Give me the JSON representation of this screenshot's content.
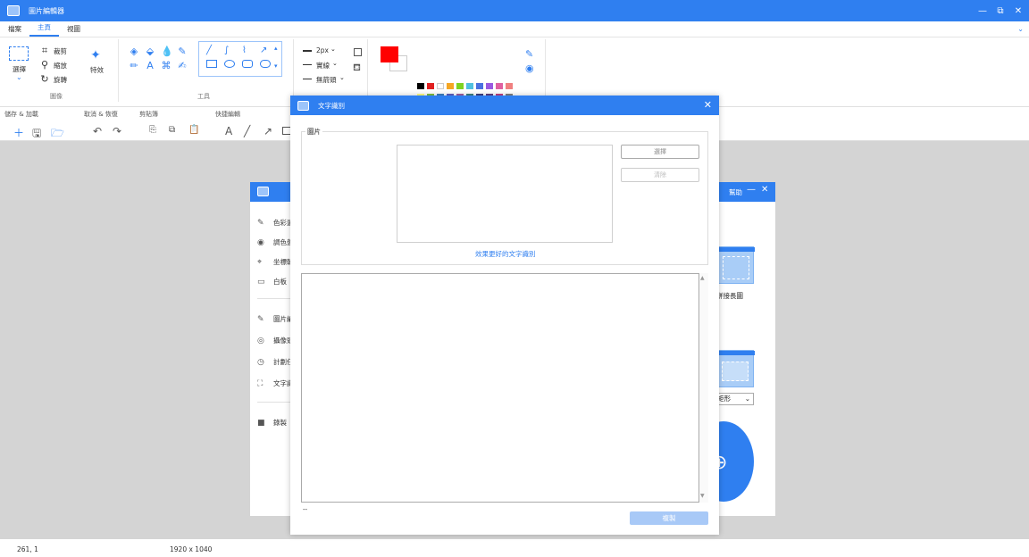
{
  "app": {
    "title": "圖片編輯器"
  },
  "menu": {
    "tabs": [
      "檔案",
      "主頁",
      "視圖"
    ]
  },
  "ribbon": {
    "image_group": {
      "label": "圖像",
      "select": "選擇",
      "crop": "裁剪",
      "resize": "縮放",
      "rotate": "旋轉",
      "effects": "特效"
    },
    "tools_group": {
      "label": "工具"
    },
    "stroke": {
      "size": "2px",
      "style": "實線",
      "arrow": "無箭頭"
    }
  },
  "toolbar2": {
    "save_load": "儲存 & 加載",
    "undo_redo": "取消 & 恢復",
    "clipboard": "剪貼簿",
    "quick_edit": "快捷編輯"
  },
  "colors": {
    "primary": "#ff0000",
    "palette_row1": [
      "#000000",
      "#e02020",
      "#ffffff",
      "#f5a623",
      "#7ed321",
      "#50c0e0",
      "#4a70e0",
      "#9b59e0",
      "#e060a0",
      "#f08080"
    ],
    "palette_row2": [
      "#ffff80",
      "#80c040",
      "#4080c0",
      "#6060c0",
      "#a060a0",
      "#408080",
      "#404080",
      "#604080",
      "#c04080",
      "#808080"
    ],
    "palette_row3": [
      "#80a060",
      "#806040",
      "#804040",
      "#406060",
      "#406040",
      "#404060",
      "#603060",
      "#604060",
      "#406040",
      "#40a0a0"
    ]
  },
  "bg_dialog": {
    "help": "幫助",
    "items": [
      "色彩選",
      "調色盤",
      "坐標軸",
      "白板",
      "圖片編",
      "攝像頭",
      "計劃任",
      "文字識",
      "錄製"
    ],
    "right_labels": [
      "拼接長圖",
      "矩形"
    ]
  },
  "ocr_dialog": {
    "title": "文字識別",
    "image_legend": "圖片",
    "select_btn": "選擇",
    "clear_btn": "清除",
    "better_link": "效果更好的文字識別",
    "result_prefix": "--",
    "copy_btn": "複製"
  },
  "status": {
    "coords": "261, 1",
    "size": "1920 x 1040"
  }
}
